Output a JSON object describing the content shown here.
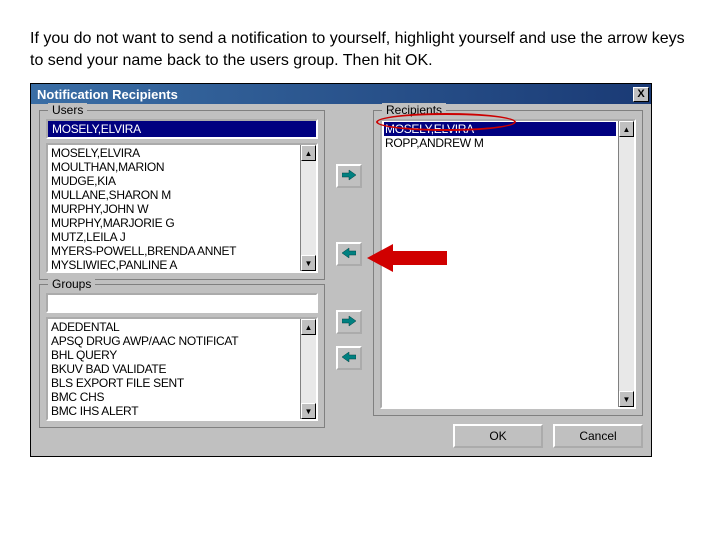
{
  "instruction_text": "If you do not want to send a notification to yourself, highlight yourself and use the arrow keys to send your name back to the users group. Then hit OK.",
  "dialog": {
    "title": "Notification Recipients",
    "close_x": "X"
  },
  "users": {
    "label": "Users",
    "filter": "MOSELY,ELVIRA",
    "items": [
      "MOSELY,ELVIRA",
      "MOULTHAN,MARION",
      "MUDGE,KIA",
      "MULLANE,SHARON M",
      "MURPHY,JOHN W",
      "MURPHY,MARJORIE G",
      "MUTZ,LEILA J",
      "MYERS-POWELL,BRENDA ANNET",
      "MYSLIWIEC,PANLINE A"
    ]
  },
  "groups": {
    "label": "Groups",
    "filter": "",
    "items": [
      "ADEDENTAL",
      "APSQ DRUG AWP/AAC NOTIFICAT",
      "BHL QUERY",
      "BKUV BAD VALIDATE",
      "BLS EXPORT FILE SENT",
      "BMC CHS",
      "BMC IHS ALERT"
    ]
  },
  "recipients": {
    "label": "Recipients",
    "items": [
      "MOSELY,ELVIRA",
      "ROPP,ANDREW M"
    ],
    "selected_index": 0
  },
  "buttons": {
    "ok": "OK",
    "cancel": "Cancel"
  },
  "scroll": {
    "up": "▲",
    "down": "▼"
  }
}
